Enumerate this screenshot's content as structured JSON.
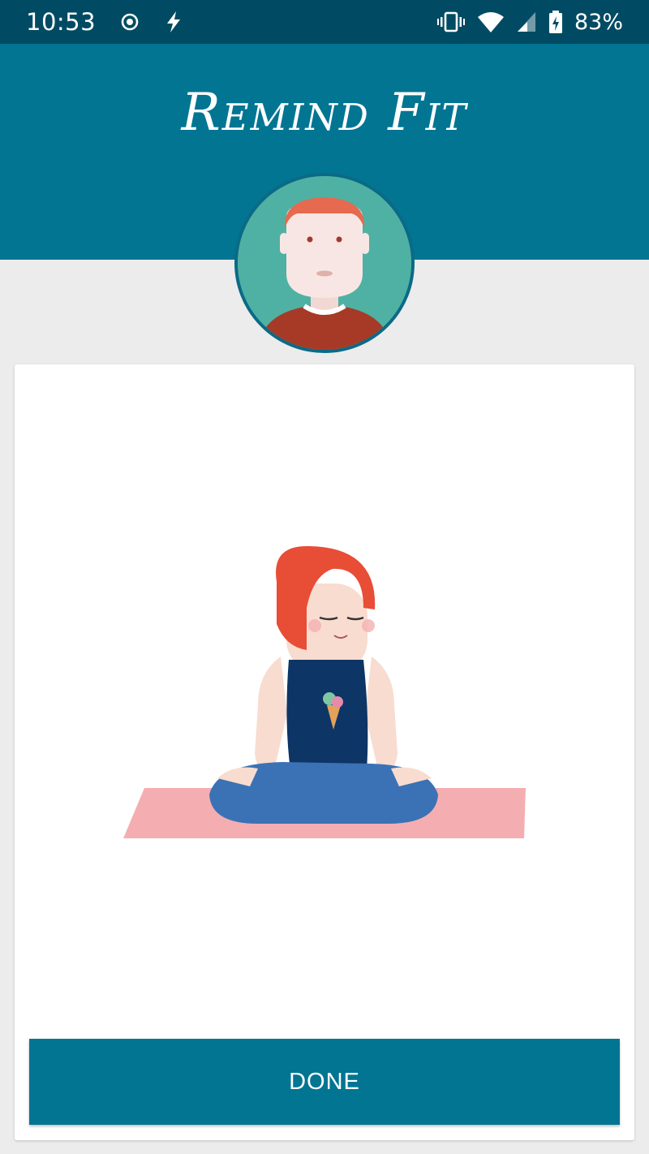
{
  "status_bar": {
    "time": "10:53",
    "battery_percent": "83%",
    "icons": [
      "target-icon",
      "flash-icon",
      "vibrate-icon",
      "wifi-icon",
      "signal-icon",
      "battery-charging-icon"
    ]
  },
  "header": {
    "title": "Remind Fit"
  },
  "avatar": {
    "icon": "user-avatar"
  },
  "exercise": {
    "illustration": "meditation-pose-illustration"
  },
  "actions": {
    "done_label": "DONE"
  },
  "colors": {
    "status_bar": "#004b63",
    "header": "#017592",
    "background": "#ececec",
    "button": "#017592"
  }
}
